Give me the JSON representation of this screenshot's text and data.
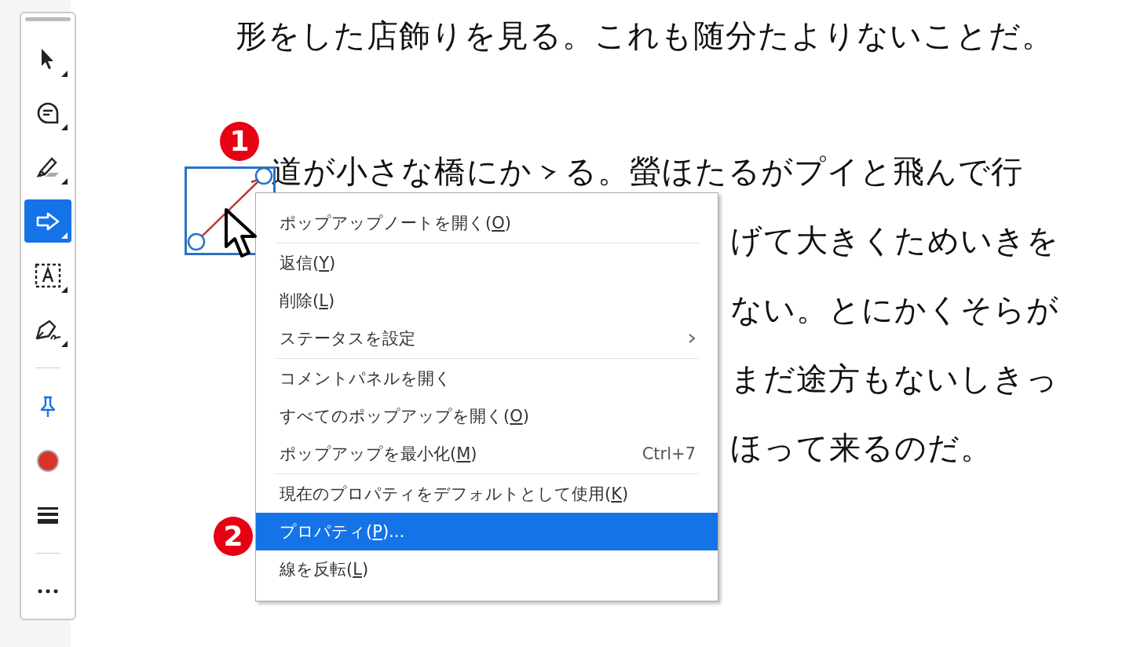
{
  "toolbar": {
    "tools": [
      {
        "kind": "select",
        "selected": false,
        "has_flyout": true
      },
      {
        "kind": "comment",
        "selected": false,
        "has_flyout": true
      },
      {
        "kind": "highlight",
        "selected": false,
        "has_flyout": true
      },
      {
        "kind": "arrow",
        "selected": true,
        "has_flyout": true
      },
      {
        "kind": "textbox",
        "selected": false,
        "has_flyout": true
      },
      {
        "kind": "sign",
        "selected": false,
        "has_flyout": true
      },
      {
        "kind": "pin",
        "selected": false,
        "divider_before": true
      },
      {
        "kind": "color",
        "selected": false,
        "color": "#d9342b"
      },
      {
        "kind": "line_weight",
        "selected": false
      },
      {
        "kind": "more",
        "selected": false,
        "divider_before": true
      }
    ]
  },
  "document": {
    "heading_line": "形をした店飾りを見る。これも随分たよりないことだ。",
    "paragraph_lines": [
      {
        "segments": [
          {
            "kind": "text",
            "text": "道が小さな橋にか"
          },
          {
            "kind": "iteration_mark"
          },
          {
            "kind": "text",
            "text": "る。螢ほたるがプイと飛んで行"
          }
        ]
      },
      {
        "right": "げて大きくためいきを"
      },
      {
        "right": "ない。とにかくそらが"
      },
      {
        "right": "まだ途方もないしきっ"
      },
      {
        "right": "ほって来るのだ。"
      }
    ]
  },
  "annotation": {
    "kind": "arrow",
    "selected": true
  },
  "callouts": [
    {
      "text": "1"
    },
    {
      "text": "2"
    }
  ],
  "context_menu": {
    "items": [
      {
        "before": "ポップアップノートを開く(",
        "mnemonic": "O",
        "after": ")",
        "selected": false
      },
      {
        "before": "返信(",
        "mnemonic": "Y",
        "after": ")",
        "selected": false,
        "separator_before": true
      },
      {
        "before": "削除(",
        "mnemonic": "L",
        "after": ")",
        "selected": false
      },
      {
        "before": "ステータスを設定",
        "selected": false,
        "submenu": true
      },
      {
        "before": "コメントパネルを開く",
        "selected": false,
        "separator_before": true
      },
      {
        "before": "すべてのポップアップを開く(",
        "mnemonic": "O",
        "after": ")",
        "selected": false
      },
      {
        "before": "ポップアップを最小化(",
        "mnemonic": "M",
        "after": ")",
        "selected": false,
        "shortcut": "Ctrl+7"
      },
      {
        "before": "現在のプロパティをデフォルトとして使用(",
        "mnemonic": "K",
        "after": ")",
        "selected": false,
        "separator_before": true
      },
      {
        "before": "プロパティ(",
        "mnemonic": "P",
        "after": ")...",
        "selected": true
      },
      {
        "before": "線を反転(",
        "mnemonic": "L",
        "after": ")",
        "selected": false
      }
    ]
  }
}
